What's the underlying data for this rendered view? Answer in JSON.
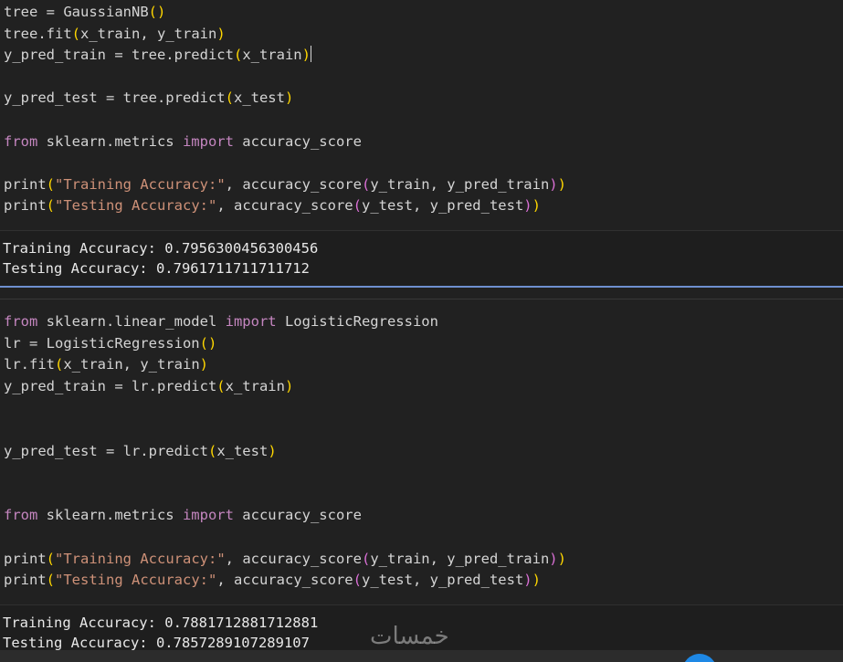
{
  "cell1": {
    "code": [
      {
        "parts": [
          {
            "t": "tree = ",
            "c": "txt"
          },
          {
            "t": "GaussianNB",
            "c": "txt"
          },
          {
            "t": "()",
            "c": "br1"
          }
        ]
      },
      {
        "parts": [
          {
            "t": "tree.fit",
            "c": "txt"
          },
          {
            "t": "(",
            "c": "br1"
          },
          {
            "t": "x_train, y_train",
            "c": "txt"
          },
          {
            "t": ")",
            "c": "br1"
          }
        ]
      },
      {
        "parts": [
          {
            "t": "y_pred_train = tree.predict",
            "c": "txt"
          },
          {
            "t": "(",
            "c": "br1"
          },
          {
            "t": "x_train",
            "c": "txt"
          },
          {
            "t": ")",
            "c": "br1"
          }
        ],
        "cursor": true
      },
      {
        "parts": []
      },
      {
        "parts": [
          {
            "t": "y_pred_test = tree.predict",
            "c": "txt"
          },
          {
            "t": "(",
            "c": "br1"
          },
          {
            "t": "x_test",
            "c": "txt"
          },
          {
            "t": ")",
            "c": "br1"
          }
        ]
      },
      {
        "parts": []
      },
      {
        "parts": [
          {
            "t": "from",
            "c": "kw"
          },
          {
            "t": " sklearn.metrics ",
            "c": "txt"
          },
          {
            "t": "import",
            "c": "kw"
          },
          {
            "t": " accuracy_score",
            "c": "txt"
          }
        ]
      },
      {
        "parts": []
      },
      {
        "parts": [
          {
            "t": "print",
            "c": "txt"
          },
          {
            "t": "(",
            "c": "br1"
          },
          {
            "t": "\"Training Accuracy:\"",
            "c": "str"
          },
          {
            "t": ", accuracy_score",
            "c": "txt"
          },
          {
            "t": "(",
            "c": "br2"
          },
          {
            "t": "y_train, y_pred_train",
            "c": "txt"
          },
          {
            "t": ")",
            "c": "br2"
          },
          {
            "t": ")",
            "c": "br1"
          }
        ]
      },
      {
        "parts": [
          {
            "t": "print",
            "c": "txt"
          },
          {
            "t": "(",
            "c": "br1"
          },
          {
            "t": "\"Testing Accuracy:\"",
            "c": "str"
          },
          {
            "t": ", accuracy_score",
            "c": "txt"
          },
          {
            "t": "(",
            "c": "br2"
          },
          {
            "t": "y_test, y_pred_test",
            "c": "txt"
          },
          {
            "t": ")",
            "c": "br2"
          },
          {
            "t": ")",
            "c": "br1"
          }
        ]
      }
    ],
    "output": [
      "Training Accuracy: 0.7956300456300456",
      "Testing Accuracy: 0.7961711711711712"
    ]
  },
  "cell2": {
    "code": [
      {
        "parts": [
          {
            "t": "from",
            "c": "kw"
          },
          {
            "t": " sklearn.linear_model ",
            "c": "txt"
          },
          {
            "t": "import",
            "c": "kw"
          },
          {
            "t": " LogisticRegression",
            "c": "txt"
          }
        ]
      },
      {
        "parts": [
          {
            "t": "lr = LogisticRegression",
            "c": "txt"
          },
          {
            "t": "()",
            "c": "br1"
          }
        ]
      },
      {
        "parts": [
          {
            "t": "lr.fit",
            "c": "txt"
          },
          {
            "t": "(",
            "c": "br1"
          },
          {
            "t": "x_train, y_train",
            "c": "txt"
          },
          {
            "t": ")",
            "c": "br1"
          }
        ]
      },
      {
        "parts": [
          {
            "t": "y_pred_train = lr.predict",
            "c": "txt"
          },
          {
            "t": "(",
            "c": "br1"
          },
          {
            "t": "x_train",
            "c": "txt"
          },
          {
            "t": ")",
            "c": "br1"
          }
        ]
      },
      {
        "parts": []
      },
      {
        "parts": []
      },
      {
        "parts": [
          {
            "t": "y_pred_test = lr.predict",
            "c": "txt"
          },
          {
            "t": "(",
            "c": "br1"
          },
          {
            "t": "x_test",
            "c": "txt"
          },
          {
            "t": ")",
            "c": "br1"
          }
        ]
      },
      {
        "parts": []
      },
      {
        "parts": []
      },
      {
        "parts": [
          {
            "t": "from",
            "c": "kw"
          },
          {
            "t": " sklearn.metrics ",
            "c": "txt"
          },
          {
            "t": "import",
            "c": "kw"
          },
          {
            "t": " accuracy_score",
            "c": "txt"
          }
        ]
      },
      {
        "parts": []
      },
      {
        "parts": [
          {
            "t": "print",
            "c": "txt"
          },
          {
            "t": "(",
            "c": "br1"
          },
          {
            "t": "\"Training Accuracy:\"",
            "c": "str"
          },
          {
            "t": ", accuracy_score",
            "c": "txt"
          },
          {
            "t": "(",
            "c": "br2"
          },
          {
            "t": "y_train, y_pred_train",
            "c": "txt"
          },
          {
            "t": ")",
            "c": "br2"
          },
          {
            "t": ")",
            "c": "br1"
          }
        ]
      },
      {
        "parts": [
          {
            "t": "print",
            "c": "txt"
          },
          {
            "t": "(",
            "c": "br1"
          },
          {
            "t": "\"Testing Accuracy:\"",
            "c": "str"
          },
          {
            "t": ", accuracy_score",
            "c": "txt"
          },
          {
            "t": "(",
            "c": "br2"
          },
          {
            "t": "y_test, y_pred_test",
            "c": "txt"
          },
          {
            "t": ")",
            "c": "br2"
          },
          {
            "t": ")",
            "c": "br1"
          }
        ]
      }
    ],
    "output": [
      "Training Accuracy: 0.7881712881712881",
      "Testing Accuracy: 0.7857289107289107"
    ]
  },
  "watermark": "خمسات",
  "colors": {
    "background": "#212121",
    "keyword": "#c586c0",
    "string": "#ce9178",
    "bracket_outer": "#ffd700",
    "bracket_inner": "#da70d6",
    "cell_focus_border": "#6e8fcf",
    "fab": "#1e88e5"
  },
  "icons": {
    "fab": "floating-action-button"
  }
}
